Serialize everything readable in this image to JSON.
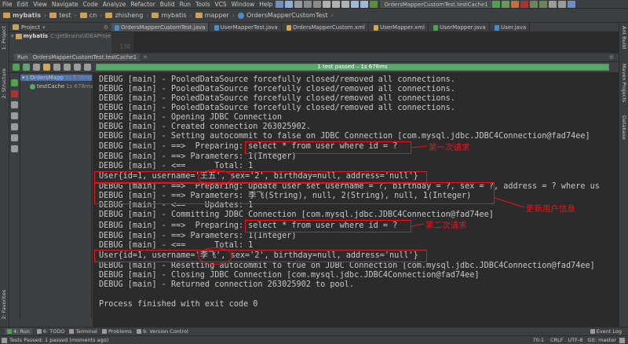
{
  "menu": [
    "File",
    "Edit",
    "View",
    "Navigate",
    "Code",
    "Analyze",
    "Refactor",
    "Build",
    "Run",
    "Tools",
    "VCS",
    "Window",
    "Help"
  ],
  "run_config": "OrdersMapperCustomTest.testCache1",
  "breadcrumb": [
    "mybatis",
    "test",
    "cn",
    "zhisheng",
    "mybatis",
    "mapper",
    "OrdersMapperCustomTest"
  ],
  "project": {
    "header": "Project",
    "root_label": "mybatis",
    "root_path": "C:\\JetBrains\\IDEAProje"
  },
  "editor_tabs": [
    "OrdersMapperCustomTest.java",
    "UserMapperTest.java",
    "OrdersMapperCustom.xml",
    "UserMapper.xml",
    "UserMapper.java",
    "User.java"
  ],
  "editor": {
    "line_number": "130"
  },
  "run": {
    "tab_label": "Run",
    "config_label": "OrdersMapperCustomTest.testCache1"
  },
  "test_status": "1 test passed – 1s 678ms",
  "test_tree": [
    {
      "label": "OrdersMapp",
      "duration": "1s 678ms"
    },
    {
      "label": "testCache",
      "duration": "1s 678ms"
    }
  ],
  "console_lines": [
    "DEBUG [main] - PooledDataSource forcefully closed/removed all connections.",
    "DEBUG [main] - PooledDataSource forcefully closed/removed all connections.",
    "DEBUG [main] - PooledDataSource forcefully closed/removed all connections.",
    "DEBUG [main] - PooledDataSource forcefully closed/removed all connections.",
    "DEBUG [main] - Opening JDBC Connection",
    "DEBUG [main] - Created connection 263025902.",
    "DEBUG [main] - Setting autocommit to false on JDBC Connection [com.mysql.jdbc.JDBC4Connection@fad74ee]",
    "DEBUG [main] - ==>  Preparing: select * from user where id = ?",
    "DEBUG [main] - ==> Parameters: 1(Integer)",
    "DEBUG [main] - <==      Total: 1",
    "User{id=1, username='王五', sex='2', birthday=null, address='null'}",
    "DEBUG [main] - ==>  Preparing: update user set username = ?, birthday = ?, sex = ?, address = ? where us",
    "DEBUG [main] - ==> Parameters: 李飞(String), null, 2(String), null, 1(Integer)",
    "DEBUG [main] - <==    Updates: 1",
    "DEBUG [main] - Committing JDBC Connection [com.mysql.jdbc.JDBC4Connection@fad74ee]",
    "DEBUG [main] - ==>  Preparing: select * from user where id = ?",
    "DEBUG [main] - ==> Parameters: 1(Integer)",
    "DEBUG [main] - <==      Total: 1",
    "User{id=1, username='李飞', sex='2', birthday=null, address='null'}",
    "DEBUG [main] - Resetting autocommit to true on JDBC Connection [com.mysql.jdbc.JDBC4Connection@fad74ee]",
    "DEBUG [main] - Closing JDBC Connection [com.mysql.jdbc.JDBC4Connection@fad74ee]",
    "DEBUG [main] - Returned connection 263025902 to pool.",
    "",
    "Process finished with exit code 0"
  ],
  "annotations": {
    "first_query": "第一次请求",
    "update_user": "更新用户信息",
    "second_query": "第二次请求"
  },
  "left_stripe": [
    "1: Project",
    "2: Structure",
    "2: Favorites"
  ],
  "right_stripe": [
    "Ant Build",
    "Maven Projects",
    "Database"
  ],
  "bottom_tools": [
    "4: Run",
    "6: TODO",
    "Terminal",
    "Problems",
    "9: Version Control",
    "Event Log"
  ],
  "status_bar": {
    "message": "Tests Passed: 1 passed (moments ago)",
    "position": "70:1",
    "line_sep": "CRLF",
    "encoding": "UTF-8",
    "vcs": "Git: master"
  },
  "colors": {
    "annotation_red": "#e8141c",
    "test_pass_green": "#59a869",
    "console_bg": "#2b2b2b",
    "ide_bg": "#3c3f41"
  }
}
